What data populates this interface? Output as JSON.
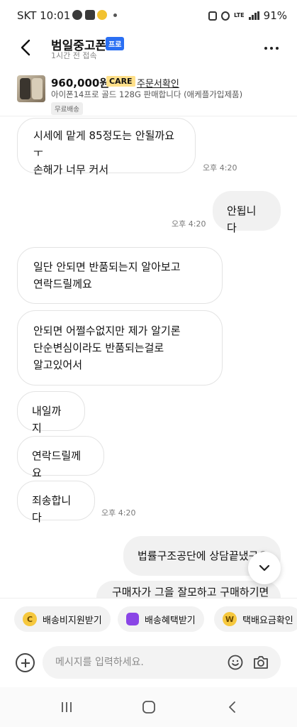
{
  "status_bar": {
    "carrier_time": "SKT 10:01",
    "network": "LTE",
    "battery": "91%"
  },
  "header": {
    "title": "범일중고폰",
    "badge": "프로",
    "subtitle": "1시간 전 접속"
  },
  "product": {
    "price": "960,000원",
    "care_badge": "CARE",
    "order_link": "주문서확인",
    "title": "아이폰14프로 골드 128G 판매합니다 (애케플가입제품)",
    "shipping_tag": "무료배송"
  },
  "messages": [
    {
      "side": "received",
      "lines": [
        "시세에 맡게 85정도는 안될까요ㅜ",
        "손해가 너무 커서"
      ],
      "time": "오후 4:20"
    },
    {
      "side": "sent",
      "lines": [
        "안됩니다"
      ],
      "time": "오후 4:20"
    },
    {
      "side": "received",
      "lines": [
        "일단 안되면 반품되는지 알아보고",
        "연락드릴께요"
      ]
    },
    {
      "side": "received",
      "lines": [
        "안되면 어쩔수없지만 제가 알기론",
        "단순변심이라도 반품되는걸로",
        "알고있어서"
      ]
    },
    {
      "side": "received",
      "lines": [
        "내일까지"
      ]
    },
    {
      "side": "received",
      "lines": [
        "연락드릴께요"
      ]
    },
    {
      "side": "received",
      "lines": [
        "죄송합니다"
      ],
      "time": "오후 4:20"
    },
    {
      "side": "sent",
      "lines": [
        "법률구조공단에 상담끝냈구요"
      ]
    },
    {
      "side": "sent",
      "lines": [
        "구매자가 그을 잘모하고 구매하기면"
      ]
    }
  ],
  "quick_actions": [
    {
      "label": "배송비지원받기",
      "icon": "C"
    },
    {
      "label": "배송혜택받기",
      "icon": ""
    },
    {
      "label": "택배요금확인",
      "icon": "W"
    }
  ],
  "input": {
    "placeholder": "메시지를 입력하세요."
  },
  "colors": {
    "pro_badge": "#2a6ff3",
    "care_badge": "#ffe08a",
    "bubble_sent": "#f1f1f1"
  }
}
